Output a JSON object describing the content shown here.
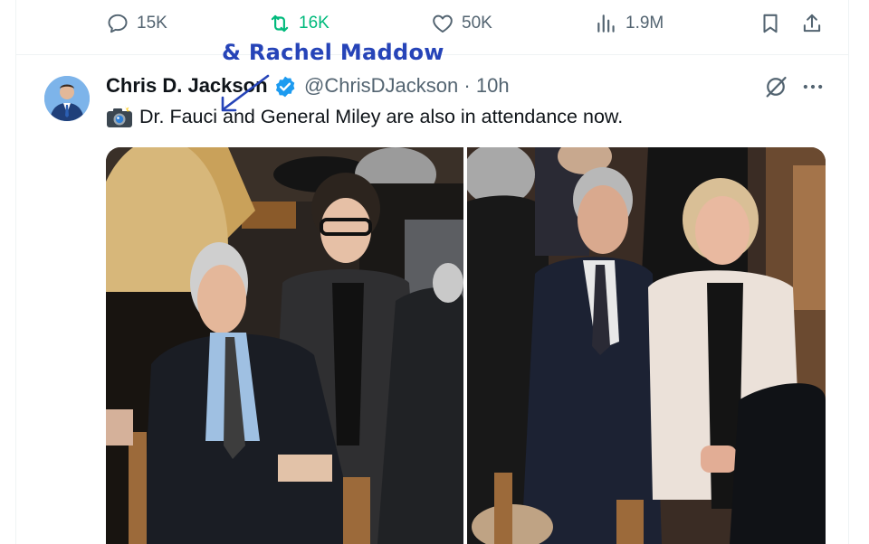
{
  "prev_actions": {
    "replies": "15K",
    "reposts": "16K",
    "likes": "50K",
    "views": "1.9M"
  },
  "annotation": "& Rachel Maddow",
  "tweet": {
    "author": "Chris D. Jackson",
    "handle": "@ChrisDJackson",
    "dot": "·",
    "time": "10h",
    "text": "Dr. Fauci and General Miley are also in attendance now."
  },
  "icons": [
    "reply-icon",
    "repost-icon",
    "like-icon",
    "views-icon",
    "bookmark-icon",
    "share-icon",
    "verified-badge-icon",
    "grok-icon",
    "more-icon",
    "camera-flash-emoji"
  ],
  "colors": {
    "repost_active": "#00ba7c",
    "verified": "#1d9bf0",
    "secondary_text": "#536471",
    "annotation": "#2644b8"
  }
}
